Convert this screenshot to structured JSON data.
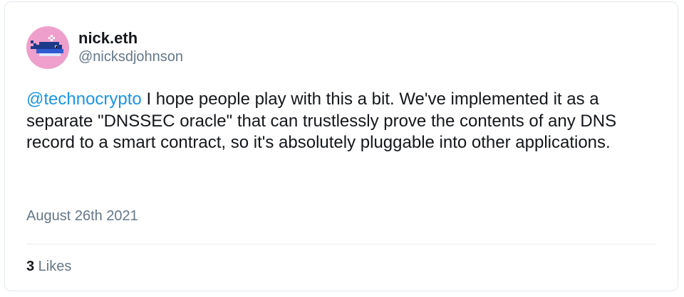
{
  "author": {
    "display_name": "nick.eth",
    "handle": "@nicksdjohnson",
    "avatar_icon": "pixel-whale-icon",
    "avatar_bg": "#ef9fcb"
  },
  "tweet": {
    "mention": "@technocrypto",
    "text": " I hope people play with this a bit. We've implemented it as a separate \"DNSSEC oracle\" that can trustlessly prove the contents of any DNS record to a smart contract, so it's absolutely pluggable into other applications.",
    "date": "August 26th 2021"
  },
  "stats": {
    "likes_count": "3",
    "likes_label": " Likes"
  },
  "colors": {
    "mention": "#1b95e0",
    "text": "#14171a",
    "muted": "#657786"
  }
}
